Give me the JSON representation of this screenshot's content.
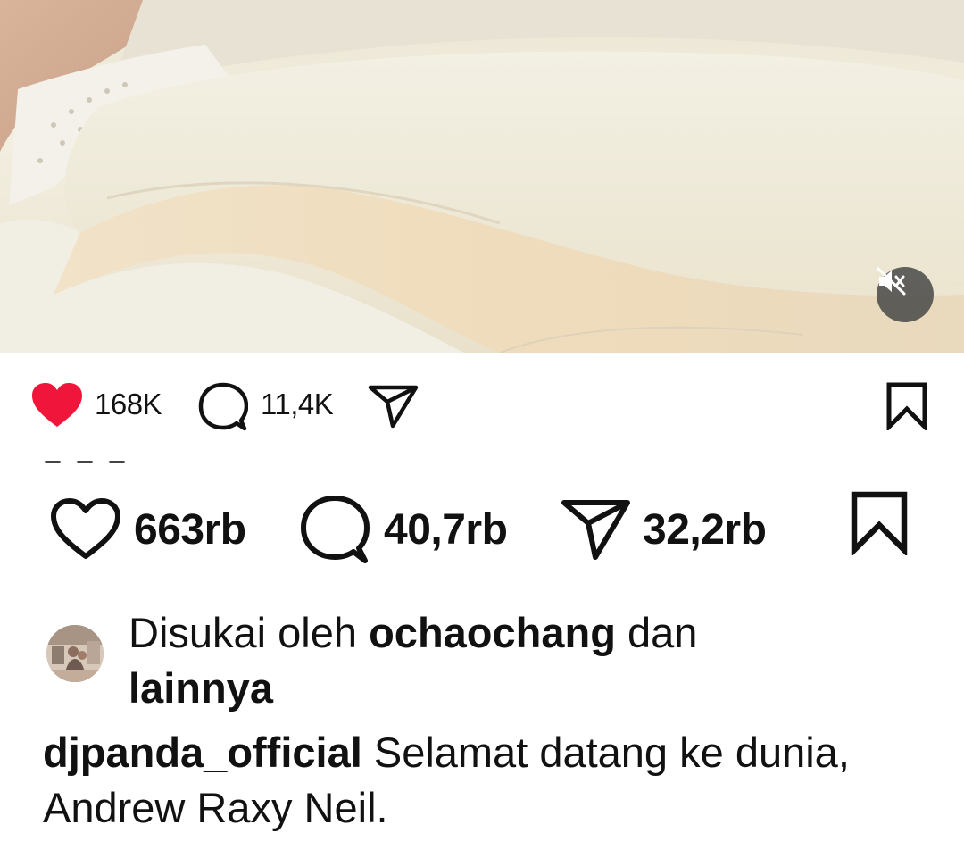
{
  "photo": {
    "mute_button_icon": "speaker-muted-icon"
  },
  "actions_small": {
    "like_count": "168K",
    "comment_count": "11,4K",
    "like_icon": "heart-filled-icon",
    "comment_icon": "comment-bubble-icon",
    "share_icon": "paper-plane-icon",
    "save_icon": "bookmark-icon",
    "like_color": "#f0163b"
  },
  "actions_large": {
    "like_count": "663rb",
    "comment_count": "40,7rb",
    "share_count": "32,2rb",
    "like_icon": "heart-outline-icon",
    "comment_icon": "comment-bubble-icon",
    "share_icon": "paper-plane-icon",
    "save_icon": "bookmark-icon"
  },
  "liked_by": {
    "prefix": "Disukai oleh ",
    "user": "ochaochang",
    "middle": " dan",
    "others": "lainnya"
  },
  "caption": {
    "username": "djpanda_official",
    "text": " Selamat datang ke dunia, Andrew Raxy Neil."
  }
}
